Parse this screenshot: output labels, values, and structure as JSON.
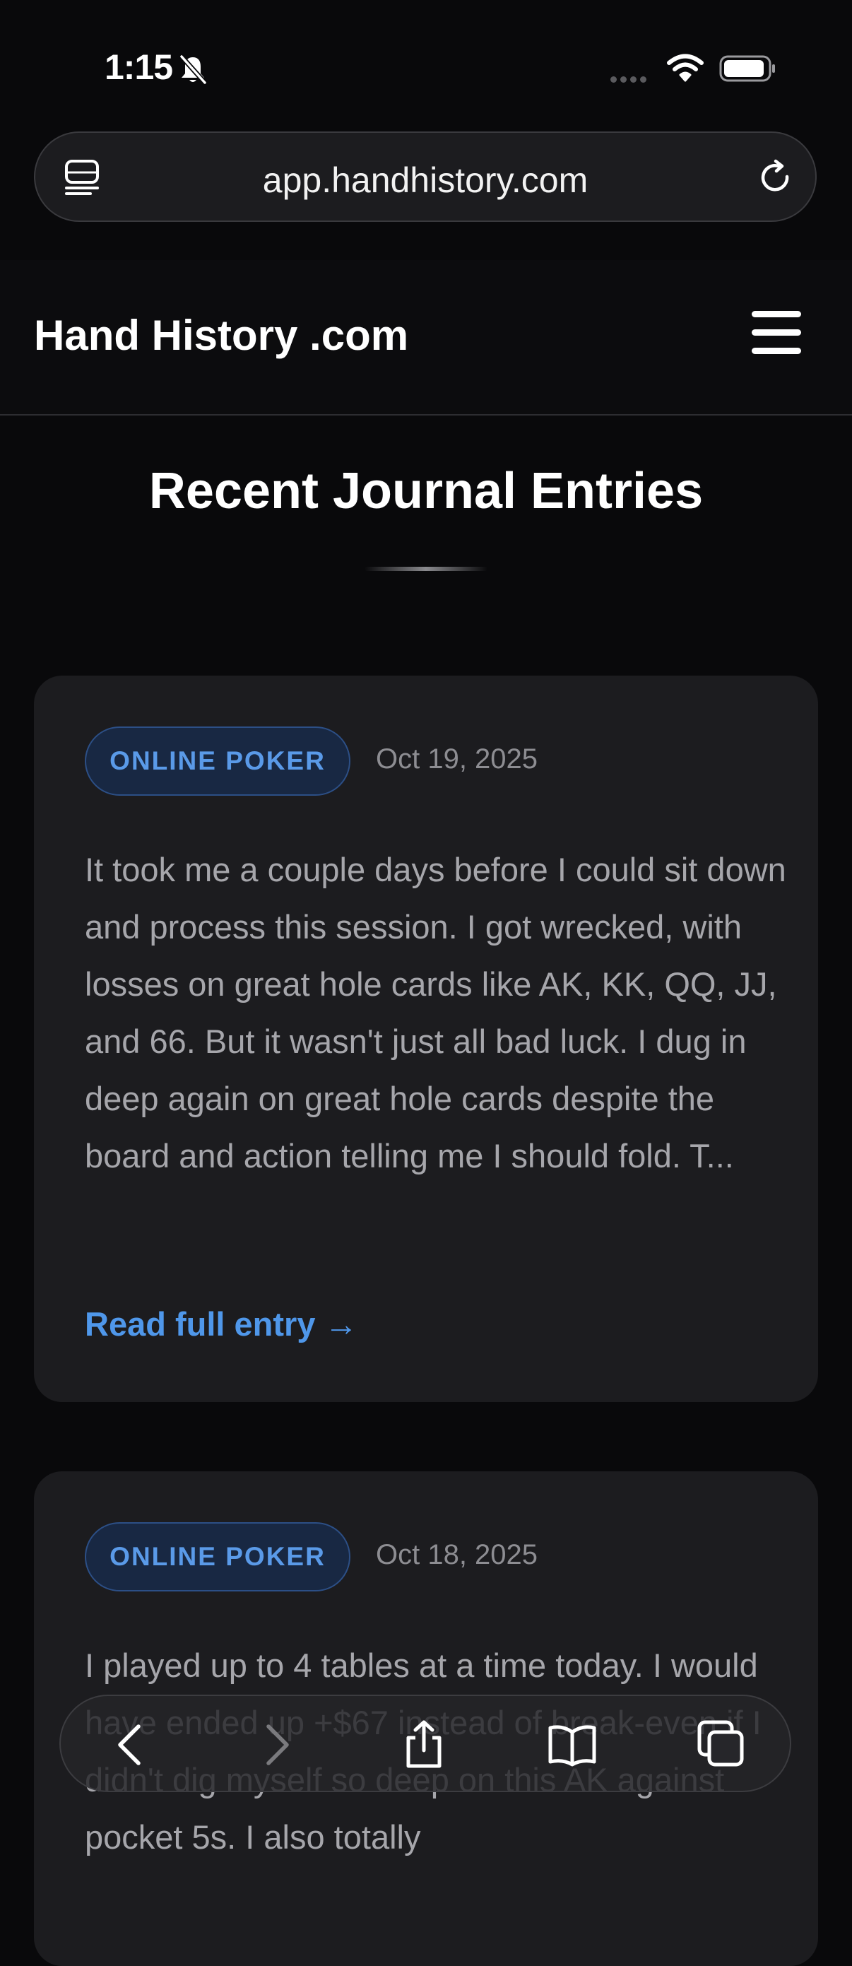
{
  "status_bar": {
    "time": "1:15"
  },
  "browser": {
    "url": "app.handhistory.com"
  },
  "header": {
    "logo": "Hand History .com"
  },
  "main": {
    "title": "Recent Journal Entries",
    "entries": [
      {
        "category": "ONLINE POKER",
        "date": "Oct 19, 2025",
        "excerpt": "It took me a couple days before I could sit down and process this session. I got wrecked, with losses on great hole cards like AK, KK, QQ, JJ, and 66. But it wasn't just all bad luck. I dug in deep again on great hole cards despite the board and action telling me I should fold. T...",
        "link": "Read full entry →"
      },
      {
        "category": "ONLINE POKER",
        "date": "Oct 18, 2025",
        "excerpt": "I played up to 4 tables at a time today. I would have ended up +$67 instead of break-even if I didn't dig myself so deep on this AK against pocket 5s. I also totally"
      }
    ]
  },
  "toolbar": {
    "icons": [
      "back-icon",
      "forward-icon",
      "share-icon",
      "bookmarks-icon",
      "tabs-icon"
    ]
  },
  "colors": {
    "background": "#09090b",
    "card": "#1c1c1f",
    "accent": "#4f97ea",
    "badge_text": "#5a9ae8"
  }
}
